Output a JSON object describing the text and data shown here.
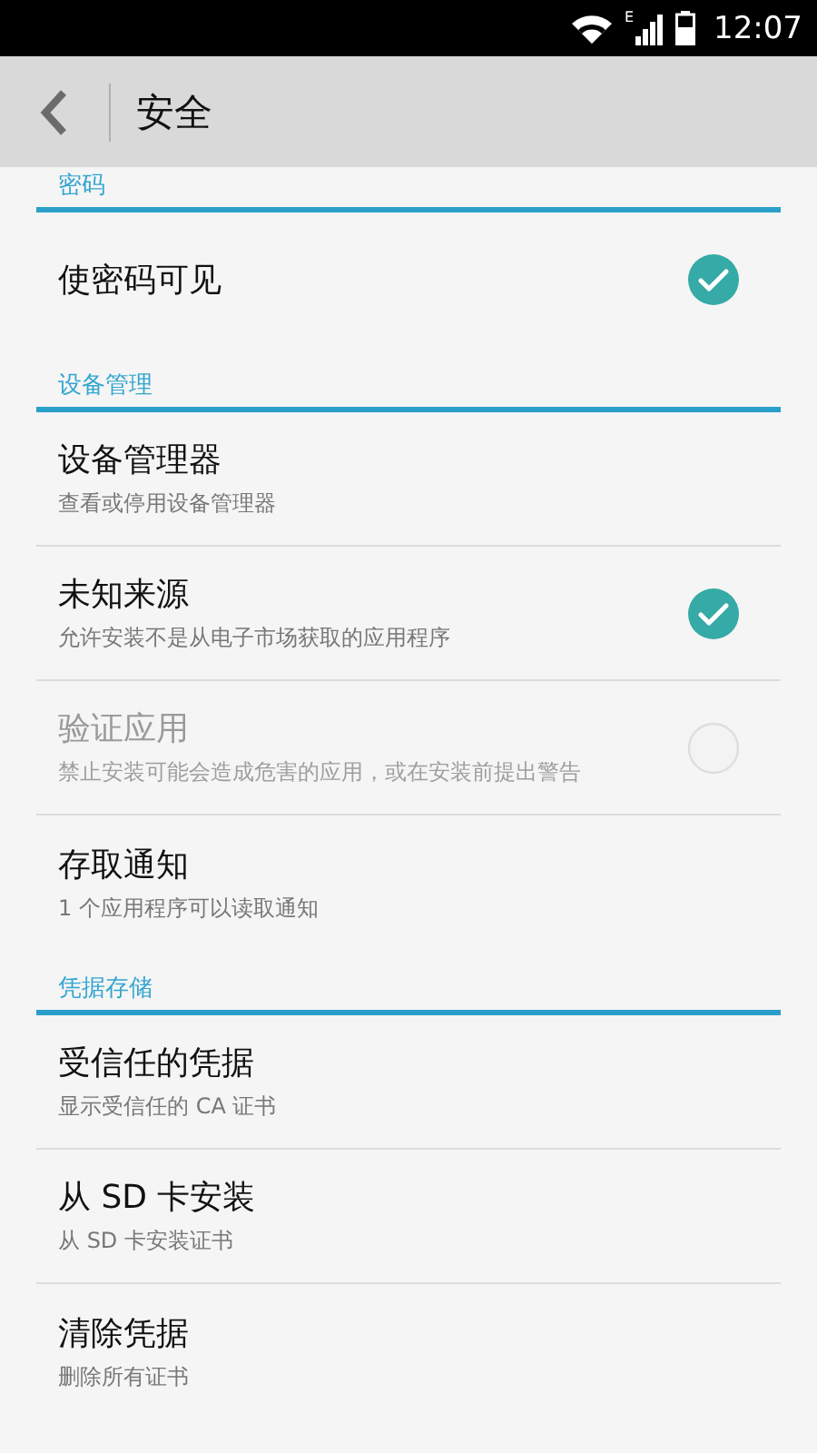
{
  "status_bar": {
    "network_type": "E",
    "time": "12:07"
  },
  "toolbar": {
    "title": "安全"
  },
  "sections": [
    {
      "header": "密码",
      "items": [
        {
          "kind": "checkbox",
          "title": "使密码可见",
          "disabled": false,
          "checked": true
        }
      ]
    },
    {
      "header": "设备管理",
      "items": [
        {
          "kind": "plain",
          "title": "设备管理器",
          "subtitle": "查看或停用设备管理器",
          "disabled": false
        },
        {
          "kind": "checkbox",
          "title": "未知来源",
          "subtitle": "允许安装不是从电子市场获取的应用程序",
          "disabled": false,
          "checked": true
        },
        {
          "kind": "checkbox",
          "title": "验证应用",
          "subtitle": "禁止安装可能会造成危害的应用，或在安装前提出警告",
          "disabled": true,
          "checked": false
        },
        {
          "kind": "plain",
          "title": "存取通知",
          "subtitle": "1 个应用程序可以读取通知",
          "disabled": false
        }
      ]
    },
    {
      "header": "凭据存储",
      "items": [
        {
          "kind": "plain",
          "title": "受信任的凭据",
          "subtitle": "显示受信任的 CA 证书",
          "disabled": false
        },
        {
          "kind": "plain",
          "title": "从 SD 卡安装",
          "subtitle": "从 SD 卡安装证书",
          "disabled": false
        },
        {
          "kind": "plain",
          "title": "清除凭据",
          "subtitle": "删除所有证书",
          "disabled": false
        }
      ]
    }
  ]
}
